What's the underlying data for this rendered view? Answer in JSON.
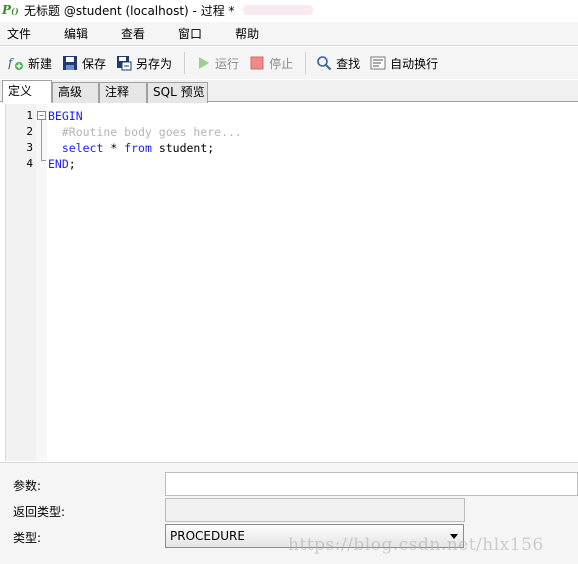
{
  "window": {
    "title": "无标题 @student (localhost) - 过程 *"
  },
  "menu": [
    "文件",
    "编辑",
    "查看",
    "窗口",
    "帮助"
  ],
  "toolbar": {
    "new": "新建",
    "save": "保存",
    "save_as": "另存为",
    "run": "运行",
    "stop": "停止",
    "find": "查找",
    "word_wrap": "自动换行"
  },
  "tabs": [
    "定义",
    "高级",
    "注释",
    "SQL 预览"
  ],
  "editor": {
    "line_numbers": [
      "1",
      "2",
      "3",
      "4"
    ],
    "lines": {
      "l1": {
        "kw": "BEGIN"
      },
      "l2": {
        "comment": "  #Routine body goes here..."
      },
      "l3": {
        "indent": "  ",
        "kw1": "select",
        "t1": " * ",
        "kw2": "from",
        "t2": " student;"
      },
      "l4": {
        "kw": "END",
        "t": ";"
      }
    }
  },
  "properties": {
    "params_label": "参数:",
    "return_type_label": "返回类型:",
    "type_label": "类型:",
    "type_value": "PROCEDURE",
    "params_value": "",
    "return_type_value": ""
  },
  "watermark": "https://blog.csdn.net/hlx156",
  "colors": {
    "keyword": "#1a1aff",
    "comment": "#b4b4b4",
    "app_icon": "#3a8a2e"
  }
}
